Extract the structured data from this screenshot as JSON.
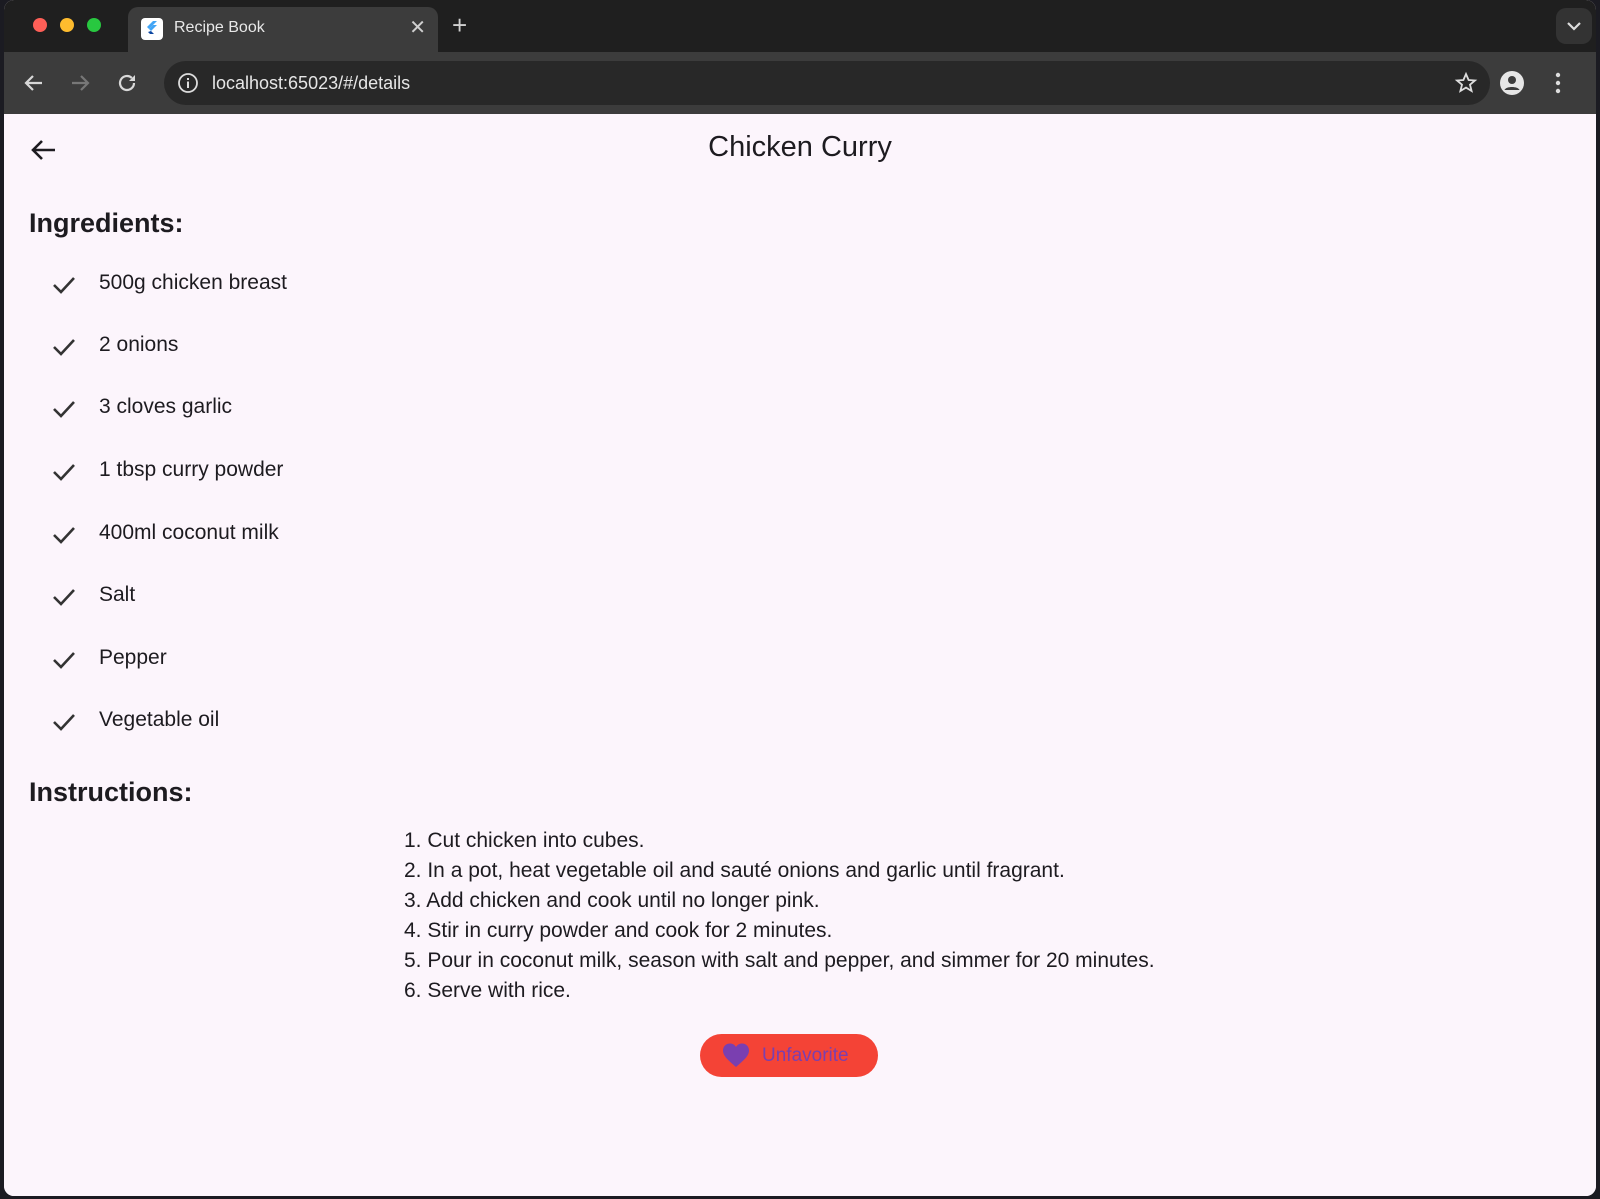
{
  "browser": {
    "tab_title": "Recipe Book",
    "tab_close": "✕",
    "new_tab": "+",
    "url": "localhost:65023/#/details"
  },
  "page": {
    "title": "Chicken Curry",
    "ingredients_heading": "Ingredients:",
    "ingredients": [
      "500g chicken breast",
      "2 onions",
      "3 cloves garlic",
      "1 tbsp curry powder",
      "400ml coconut milk",
      "Salt",
      "Pepper",
      "Vegetable oil"
    ],
    "instructions_heading": "Instructions:",
    "instructions": [
      "1. Cut chicken into cubes.",
      "2. In a pot, heat vegetable oil and sauté onions and garlic until fragrant.",
      "3. Add chicken and cook until no longer pink.",
      "4. Stir in curry powder and cook for 2 minutes.",
      "5. Pour in coconut milk, season with salt and pepper, and simmer for 20 minutes.",
      "6. Serve with rice."
    ],
    "favorite_button_label": "Unfavorite"
  },
  "icons": {
    "back": "arrow-left-icon",
    "check": "check-icon",
    "favorite": "heart-icon"
  },
  "colors": {
    "page_background": "#fcf5fc",
    "favorite_button": "#f44336",
    "favorite_icon": "#7a3fb0"
  }
}
